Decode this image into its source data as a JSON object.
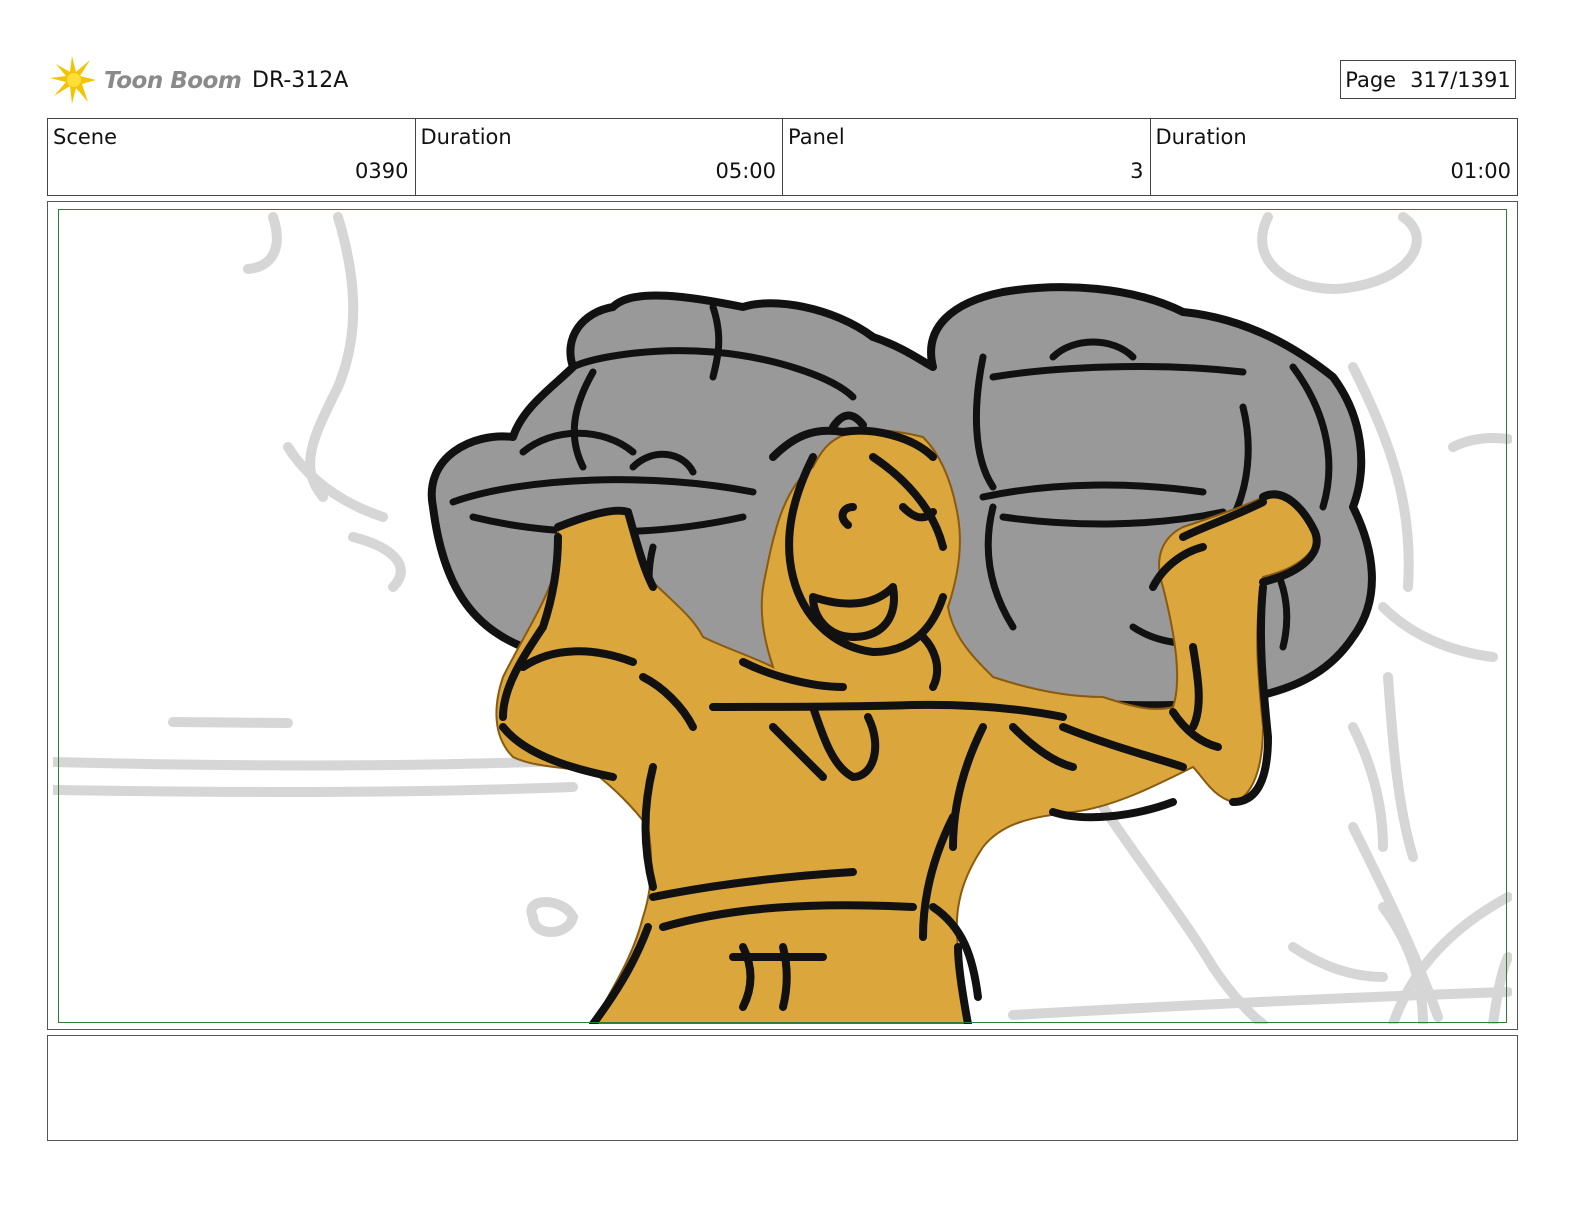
{
  "header": {
    "logo_text": "Toon Boom",
    "doc_code": "DR-312A",
    "page_label": "Page",
    "page_value": "317/1391"
  },
  "info": {
    "scene_label": "Scene",
    "scene_value": "0390",
    "scene_duration_label": "Duration",
    "scene_duration_value": "05:00",
    "panel_label": "Panel",
    "panel_value": "3",
    "panel_duration_label": "Duration",
    "panel_duration_value": "01:00"
  },
  "notes": {
    "text": ""
  },
  "colors": {
    "logo_accent": "#f5c400",
    "safe_frame": "#2e7d32",
    "character_fill": "#dba63c",
    "rocks_fill": "#999999",
    "background_sketch": "#d6d6d6"
  }
}
